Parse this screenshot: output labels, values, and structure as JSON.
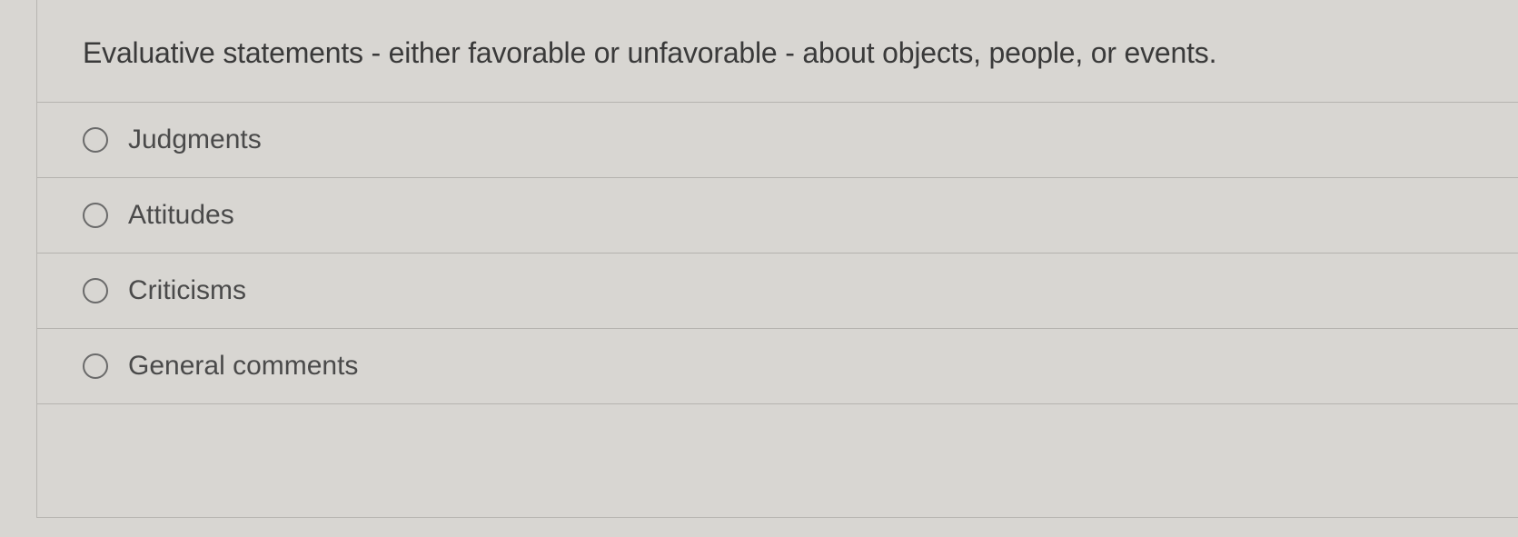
{
  "question": {
    "text": "Evaluative statements - either favorable or unfavorable - about objects, people, or events."
  },
  "options": [
    {
      "label": "Judgments"
    },
    {
      "label": "Attitudes"
    },
    {
      "label": "Criticisms"
    },
    {
      "label": "General comments"
    }
  ]
}
